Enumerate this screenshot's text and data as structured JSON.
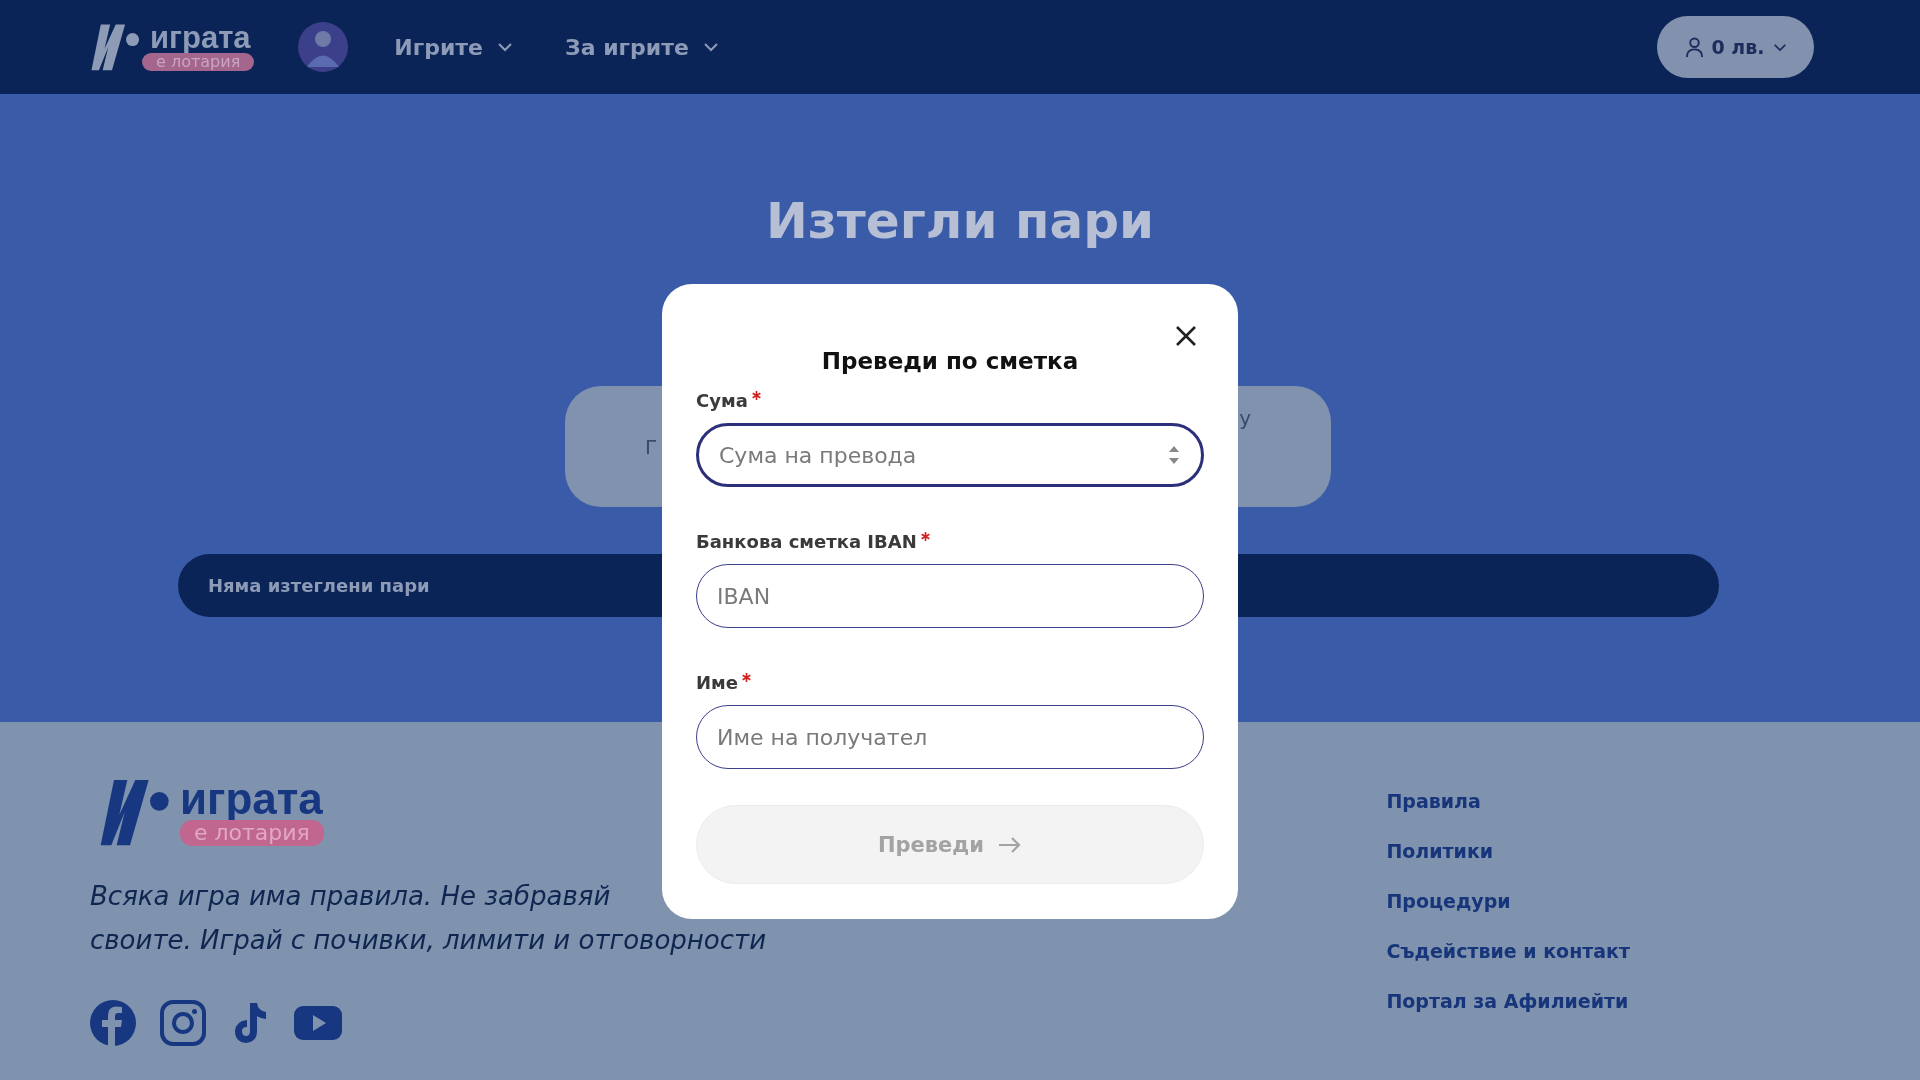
{
  "header": {
    "logo": {
      "word": "играта",
      "tagline": "е лотария"
    },
    "nav": [
      {
        "label": "Игрите"
      },
      {
        "label": "За игрите"
      }
    ],
    "account": {
      "balance": "0 лв."
    }
  },
  "page": {
    "title": "Изтегли пари",
    "tiles": [
      {
        "fragment": "Г"
      },
      {
        "fragment": "у"
      }
    ],
    "notice": "Няма изтеглени пари"
  },
  "modal": {
    "title": "Преведи по сметка",
    "fields": [
      {
        "label": "Сума",
        "required": true,
        "placeholder": "Сума на превода",
        "kind": "number",
        "focused": true
      },
      {
        "label": "Банкова сметка IBAN",
        "required": true,
        "placeholder": "IBAN",
        "kind": "text",
        "focused": false
      },
      {
        "label": "Име",
        "required": true,
        "placeholder": "Име на получател",
        "kind": "text",
        "focused": false
      }
    ],
    "submit": {
      "label": "Преведи",
      "disabled": true
    }
  },
  "footer": {
    "logo": {
      "word": "играта",
      "tagline": "е лотария"
    },
    "motto_lines": [
      "Всяка игра има правила. Не забравяй",
      "своите. Играй с почивки, лимити и отговорности"
    ],
    "social": [
      {
        "kind": "facebook"
      },
      {
        "kind": "instagram"
      },
      {
        "kind": "tiktok"
      },
      {
        "kind": "youtube"
      }
    ],
    "links": [
      {
        "label": "Правила"
      },
      {
        "label": "Политики"
      },
      {
        "label": "Процедури"
      },
      {
        "label": "Съдействие и контакт"
      },
      {
        "label": "Портал за Афилиейти"
      }
    ]
  }
}
